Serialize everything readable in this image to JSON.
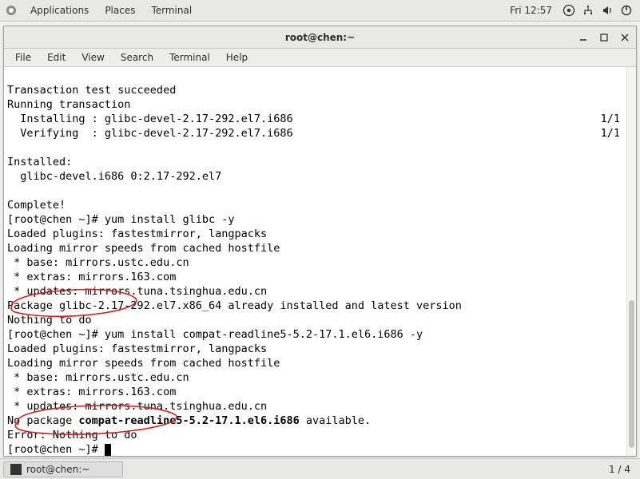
{
  "panel": {
    "apps": "Applications",
    "places": "Places",
    "terminal": "Terminal",
    "time": "Fri 12:57"
  },
  "window": {
    "title": "root@chen:~"
  },
  "menubar": {
    "file": "File",
    "edit": "Edit",
    "view": "View",
    "search": "Search",
    "terminal": "Terminal",
    "help": "Help"
  },
  "term": {
    "l01": "Transaction test succeeded",
    "l02": "Running transaction",
    "l03": "  Installing : glibc-devel-2.17-292.el7.i686",
    "l03r": "1/1",
    "l04": "  Verifying  : glibc-devel-2.17-292.el7.i686",
    "l04r": "1/1",
    "l05": "",
    "l06": "Installed:",
    "l07": "  glibc-devel.i686 0:2.17-292.el7",
    "l08": "",
    "l09": "Complete!",
    "l10": "[root@chen ~]# yum install glibc -y",
    "l11": "Loaded plugins: fastestmirror, langpacks",
    "l12": "Loading mirror speeds from cached hostfile",
    "l13": " * base: mirrors.ustc.edu.cn",
    "l14": " * extras: mirrors.163.com",
    "l15": " * updates: mirrors.tuna.tsinghua.edu.cn",
    "l16": "Package glibc-2.17-292.el7.x86_64 already installed and latest version",
    "l17": "Nothing to do",
    "l18": "[root@chen ~]# yum install compat-readline5-5.2-17.1.el6.i686 -y",
    "l19": "Loaded plugins: fastestmirror, langpacks",
    "l20": "Loading mirror speeds from cached hostfile",
    "l21": " * base: mirrors.ustc.edu.cn",
    "l22": " * extras: mirrors.163.com",
    "l23": " * updates: mirrors.tuna.tsinghua.edu.cn",
    "l24a": "No package ",
    "l24b": "compat-readline5-5.2-17.1.el6.i686",
    "l24c": " available.",
    "l25": "Error: Nothing to do",
    "l26": "[root@chen ~]# "
  },
  "taskbar": {
    "task1": "root@chen:~",
    "ws": "1 / 4"
  }
}
